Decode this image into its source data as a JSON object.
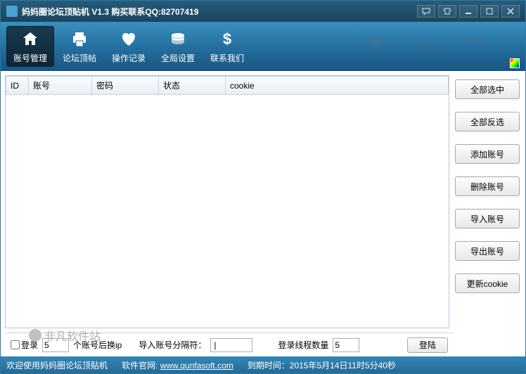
{
  "title": "妈妈圈论坛顶贴机  V1.3  购买联系QQ:82707419",
  "toolbar": [
    {
      "label": "账号管理",
      "icon": "home",
      "active": true
    },
    {
      "label": "论坛顶帖",
      "icon": "printer",
      "active": false
    },
    {
      "label": "操作记录",
      "icon": "heart",
      "active": false
    },
    {
      "label": "全局设置",
      "icon": "stack",
      "active": false
    },
    {
      "label": "联系我们",
      "icon": "dollar",
      "active": false
    }
  ],
  "columns": [
    "ID",
    "账号",
    "密码",
    "状态",
    "cookie"
  ],
  "side_buttons": [
    "全部选中",
    "全部反选",
    "添加账号",
    "删除账号",
    "导入账号",
    "导出账号",
    "更新cookie"
  ],
  "bottom": {
    "login_check_label": "登录",
    "login_count": "5",
    "ip_suffix_text": "个账号后换ip",
    "import_sep_label": "导入账号分隔符：",
    "import_sep_value": "|",
    "thread_label": "登录线程数量",
    "thread_value": "5",
    "login_btn": "登陆"
  },
  "status": {
    "welcome": "欢迎使用妈妈圈论坛顶贴机",
    "site_label": "软件官网:",
    "site_url": "www.qunfasoft.com",
    "expire_label": "到期时间：",
    "expire_value": "2015年5月14日11时5分40秒"
  },
  "watermark": "非凡软件站"
}
